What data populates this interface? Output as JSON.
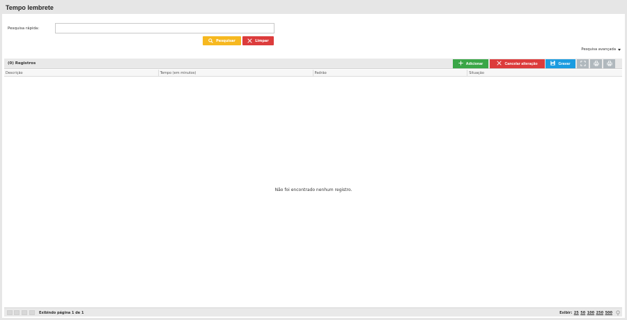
{
  "page": {
    "title": "Tempo lembrete"
  },
  "search": {
    "label": "Pesquisa rápida:",
    "value": "",
    "placeholder": "",
    "search_button": "Pesquisar",
    "clear_button": "Limpar",
    "advanced_label": "Pesquisa avançada"
  },
  "grid": {
    "count_label": "(0) Registros",
    "buttons": {
      "add": "Adicionar",
      "cancel": "Cancelar alteração",
      "save": "Gravar"
    },
    "columns": [
      "Descrição",
      "Tempo (em minutos)",
      "Padrão",
      "Situação"
    ],
    "empty_message": "Não foi encontrado nenhum registro."
  },
  "footer": {
    "page_info": "Exibindo página 1 de 1",
    "show_label": "Exibir:",
    "page_sizes": [
      "25",
      "50",
      "100",
      "250",
      "500"
    ]
  },
  "icons": {
    "search": "magnifier-icon",
    "clear": "x-icon",
    "add": "plus-icon",
    "cancel": "x-icon",
    "save": "floppy-icon",
    "fullscreen": "expand-icon",
    "print": "printer-icon",
    "settings": "settings-icon",
    "advanced": "caret-down-icon"
  },
  "colors": {
    "search_button": "#f6b820",
    "clear_button": "#dc3c3c",
    "add_button": "#3aa647",
    "cancel_button": "#dc3c3c",
    "save_button": "#1b9ce0",
    "icon_button": "#b0b8bd"
  }
}
